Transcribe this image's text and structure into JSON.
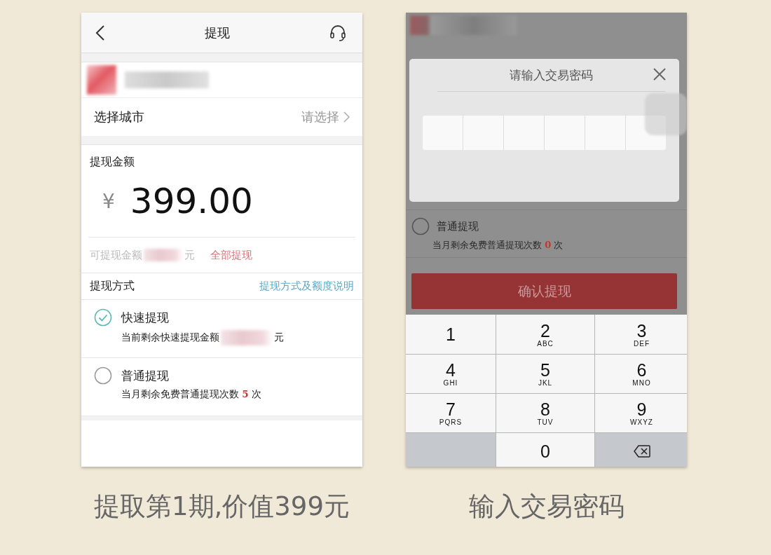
{
  "withdraw_screen": {
    "nav": {
      "title": "提现"
    },
    "city_row": {
      "label": "选择城市",
      "value": "请选择"
    },
    "amount": {
      "label": "提现金额",
      "currency": "¥",
      "value": "399.00"
    },
    "available": {
      "label": "可提现金额",
      "unit": "元",
      "link": "全部提现"
    },
    "method": {
      "label": "提现方式",
      "link": "提现方式及额度说明"
    },
    "options": [
      {
        "kind": "amount",
        "title": "快速提现",
        "note": "当前剩余快速提现金额",
        "unit": "元",
        "selected": true
      },
      {
        "kind": "count",
        "title": "普通提现",
        "note": "当月剩余免费普通提现次数",
        "count": "5",
        "unit": "次",
        "selected": false
      }
    ]
  },
  "password_screen": {
    "background": {
      "option": {
        "kind": "count",
        "title": "普通提现",
        "note": "当月剩余免费普通提现次数",
        "count": "0",
        "unit": "次",
        "selected": false
      },
      "confirm_button": "确认提现"
    },
    "dialog": {
      "title": "请输入交易密码"
    },
    "keypad": [
      {
        "kind": "digit",
        "digit": "1"
      },
      {
        "kind": "digit",
        "digit": "2",
        "letters": "ABC"
      },
      {
        "kind": "digit",
        "digit": "3",
        "letters": "DEF"
      },
      {
        "kind": "digit",
        "digit": "4",
        "letters": "GHI"
      },
      {
        "kind": "digit",
        "digit": "5",
        "letters": "JKL"
      },
      {
        "kind": "digit",
        "digit": "6",
        "letters": "MNO"
      },
      {
        "kind": "digit",
        "digit": "7",
        "letters": "PQRS"
      },
      {
        "kind": "digit",
        "digit": "8",
        "letters": "TUV"
      },
      {
        "kind": "digit",
        "digit": "9",
        "letters": "WXYZ"
      },
      {
        "kind": "blank"
      },
      {
        "kind": "digit",
        "digit": "0"
      },
      {
        "kind": "delete"
      }
    ]
  },
  "captions": [
    "提取第1期,价值399元",
    "输入交易密码"
  ]
}
